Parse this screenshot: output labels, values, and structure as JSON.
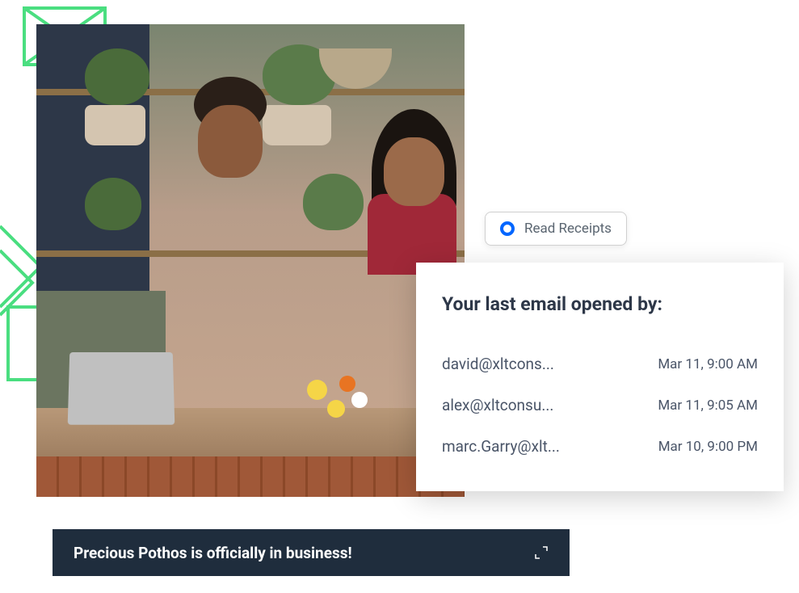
{
  "badge": {
    "label": "Read Receipts"
  },
  "card": {
    "title": "Your last email opened by:",
    "rows": [
      {
        "email": "david@xltcons...",
        "time": "Mar 11, 9:00 AM"
      },
      {
        "email": "alex@xltconsu...",
        "time": "Mar 11, 9:05 AM"
      },
      {
        "email": "marc.Garry@xlt...",
        "time": "Mar 10, 9:00 PM"
      }
    ]
  },
  "banner": {
    "text": "Precious Pothos is officially in business!"
  }
}
